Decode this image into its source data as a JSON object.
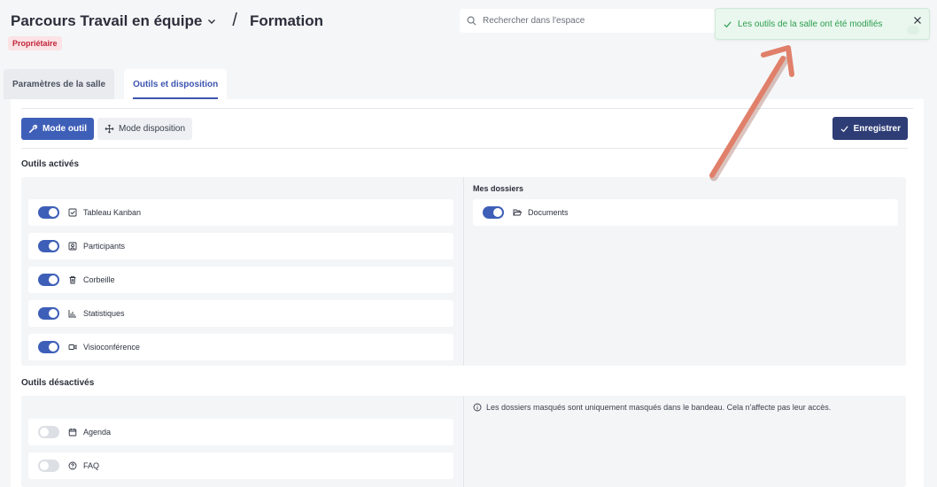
{
  "header": {
    "space_name": "Parcours Travail en équipe",
    "separator": "/",
    "room_name": "Formation",
    "badge": "Propriétaire"
  },
  "search": {
    "placeholder": "Rechercher dans l'espace"
  },
  "toast": {
    "message": "Les outils de la salle ont été modifiés"
  },
  "tabs": [
    {
      "label": "Paramètres de la salle",
      "active": false
    },
    {
      "label": "Outils et disposition",
      "active": true
    }
  ],
  "toolbar": {
    "tool_mode": "Mode outil",
    "layout_mode": "Mode disposition",
    "save": "Enregistrer"
  },
  "active_tools": {
    "title": "Outils activés",
    "items": [
      {
        "label": "Tableau Kanban",
        "icon": "checkbox-icon",
        "enabled": true
      },
      {
        "label": "Participants",
        "icon": "user-card-icon",
        "enabled": true
      },
      {
        "label": "Corbeille",
        "icon": "trash-icon",
        "enabled": true
      },
      {
        "label": "Statistiques",
        "icon": "bar-chart-icon",
        "enabled": true
      },
      {
        "label": "Visioconférence",
        "icon": "video-icon",
        "enabled": true
      }
    ]
  },
  "my_folders": {
    "title": "Mes dossiers",
    "items": [
      {
        "label": "Documents",
        "icon": "folder-open-icon",
        "enabled": true
      }
    ]
  },
  "inactive_tools": {
    "title": "Outils désactivés",
    "items": [
      {
        "label": "Agenda",
        "icon": "calendar-icon",
        "enabled": false
      },
      {
        "label": "FAQ",
        "icon": "help-circle-icon",
        "enabled": false
      }
    ]
  },
  "hidden_folders_info": "Les dossiers masqués sont uniquement masqués dans le bandeau. Cela n'affecte pas leur accès.",
  "colors": {
    "primary": "#3e5fb8",
    "save": "#2e3d75",
    "success": "#2e9e4f",
    "badge": "#c0263a",
    "annotation_arrow": "#e0806a"
  }
}
